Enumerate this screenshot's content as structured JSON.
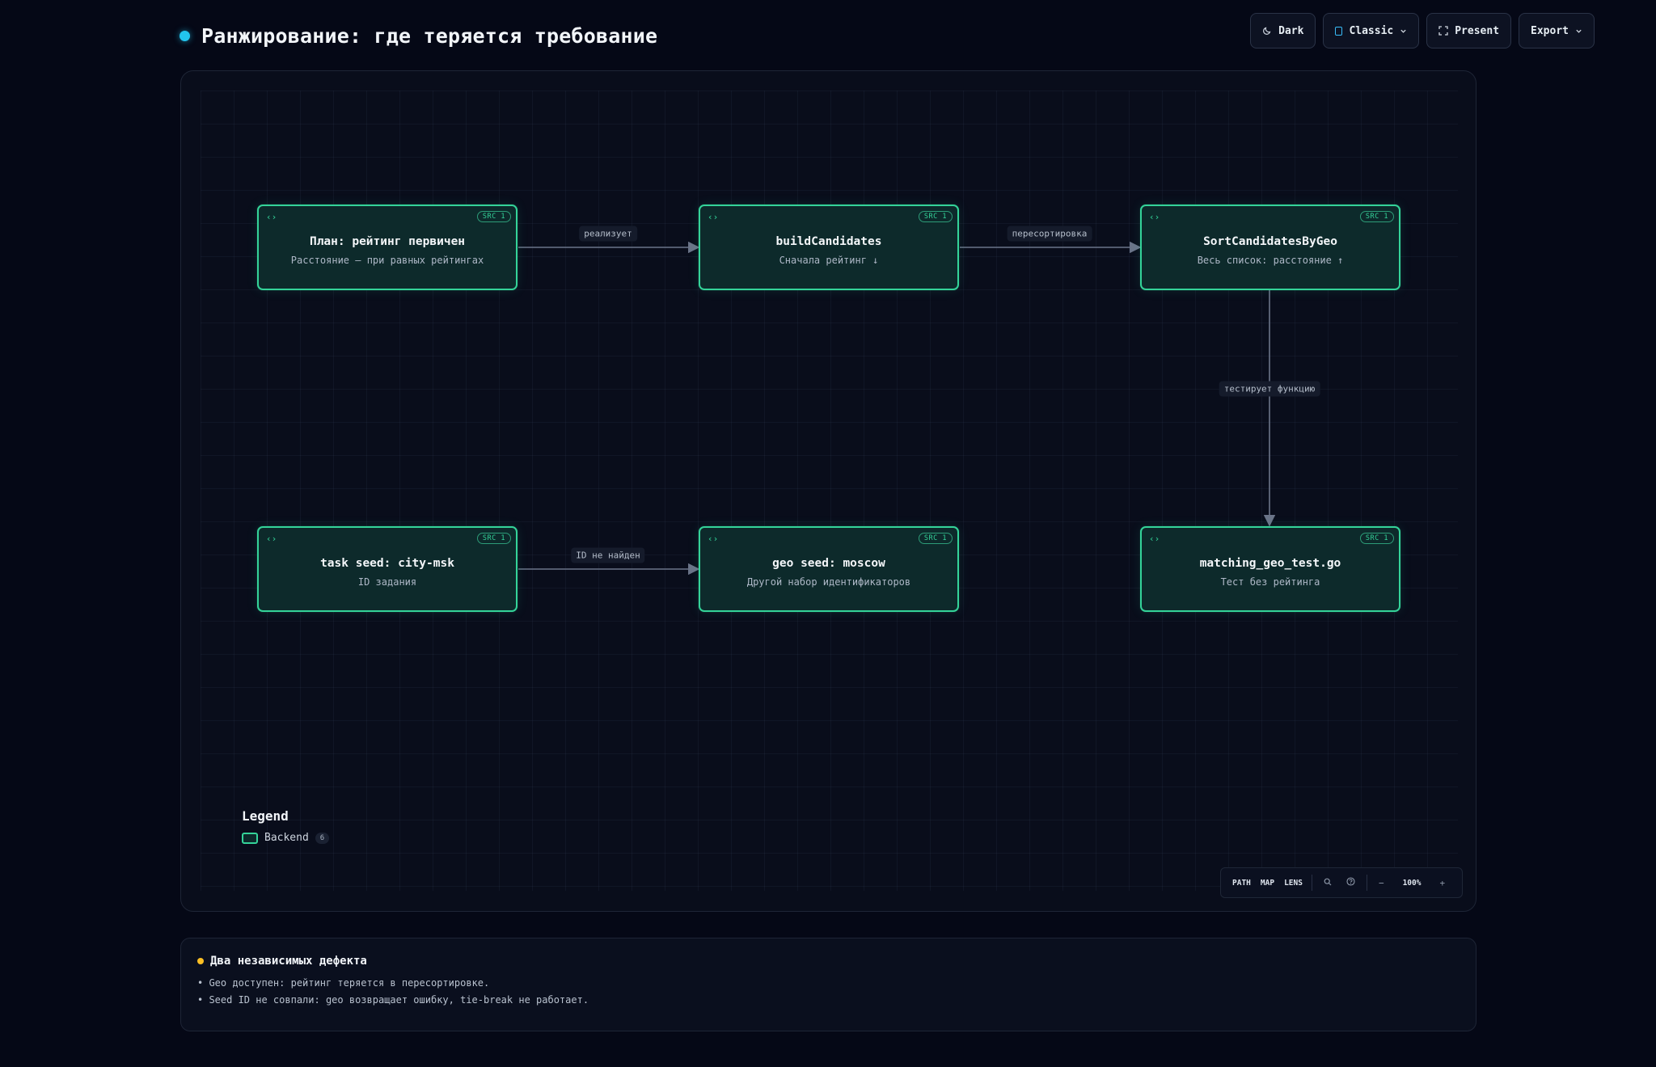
{
  "header": {
    "title": "Ранжирование: где теряется требование",
    "accent": "#22c4ee"
  },
  "toolbar": {
    "dark_label": "Dark",
    "classic_label": "Classic",
    "present_label": "Present",
    "export_label": "Export"
  },
  "nodes": [
    {
      "title": "План: рейтинг первичен",
      "subtitle": "Расстояние — при равных рейтингах",
      "badge": "SRC 1"
    },
    {
      "title": "buildCandidates",
      "subtitle": "Сначала рейтинг ↓",
      "badge": "SRC 1"
    },
    {
      "title": "SortCandidatesByGeo",
      "subtitle": "Весь список: расстояние ↑",
      "badge": "SRC 1"
    },
    {
      "title": "task seed: city-msk",
      "subtitle": "ID задания",
      "badge": "SRC 1"
    },
    {
      "title": "geo seed: moscow",
      "subtitle": "Другой набор идентификаторов",
      "badge": "SRC 1"
    },
    {
      "title": "matching_geo_test.go",
      "subtitle": "Тест без рейтинга",
      "badge": "SRC 1"
    }
  ],
  "edges": [
    {
      "from": 0,
      "to": 1,
      "label": "реализует"
    },
    {
      "from": 1,
      "to": 2,
      "label": "пересортировка"
    },
    {
      "from": 2,
      "to": 5,
      "label": "тестирует функцию"
    },
    {
      "from": 3,
      "to": 4,
      "label": "ID не найден"
    }
  ],
  "legend": {
    "title": "Legend",
    "items": [
      {
        "label": "Backend",
        "count": "6",
        "color": "#34d399"
      }
    ]
  },
  "controls": {
    "path": "PATH",
    "map": "MAP",
    "lens": "LENS",
    "minus": "−",
    "zoom": "100%",
    "plus": "+"
  },
  "notes": {
    "title": "Два независимых дефекта",
    "lines": [
      "• Geo доступен: рейтинг теряется в пересортировке.",
      "• Seed ID не совпали: geo возвращает ошибку, tie-break не работает."
    ],
    "accent": "#fbbf24"
  },
  "colors": {
    "node_border": "#34d399",
    "node_fill": "#0d2a2b",
    "edge": "#6b7489"
  }
}
